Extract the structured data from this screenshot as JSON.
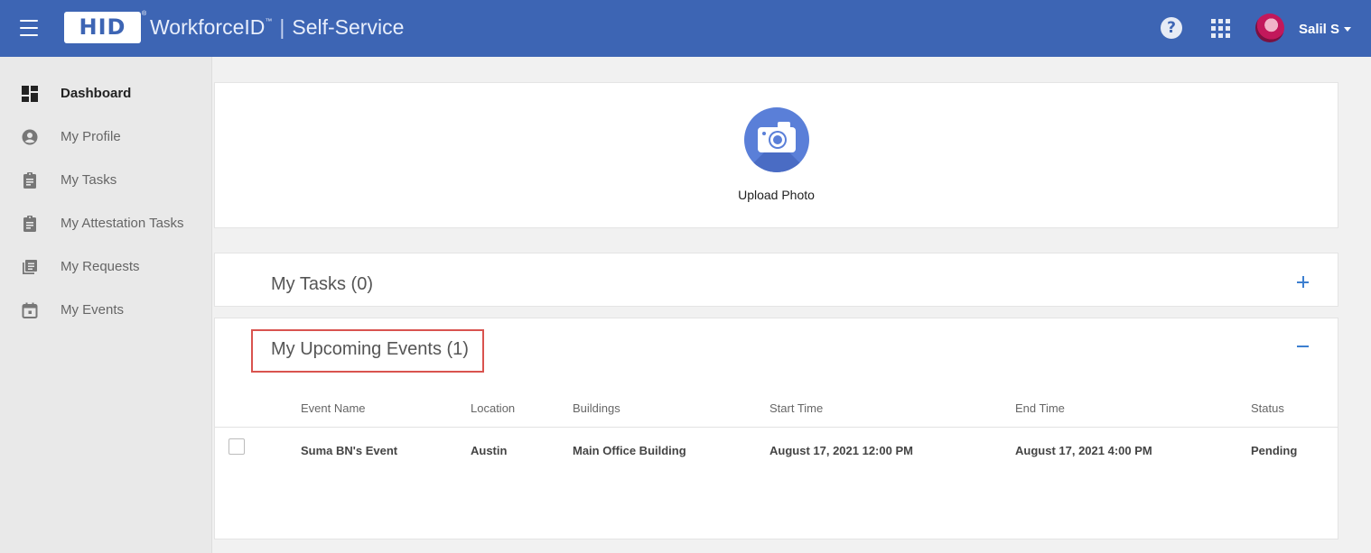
{
  "header": {
    "logo_text": "HID",
    "logo_mark": "®",
    "product_name": "WorkforceID",
    "product_tm": "™",
    "separator": "|",
    "service_name": "Self-Service",
    "help_glyph": "?",
    "user_name": "Salil S",
    "colors": {
      "bar": "#3d65b4"
    }
  },
  "sidebar": {
    "items": [
      {
        "label": "Dashboard",
        "icon": "dashboard-icon",
        "active": true
      },
      {
        "label": "My Profile",
        "icon": "account-circle-icon",
        "active": false
      },
      {
        "label": "My Tasks",
        "icon": "clipboard-icon",
        "active": false
      },
      {
        "label": "My Attestation Tasks",
        "icon": "clipboard-icon",
        "active": false
      },
      {
        "label": "My Requests",
        "icon": "list-stack-icon",
        "active": false
      },
      {
        "label": "My Events",
        "icon": "calendar-icon",
        "active": false
      }
    ]
  },
  "photo_card": {
    "upload_label": "Upload Photo"
  },
  "tasks_panel": {
    "title": "My Tasks (0)",
    "toggle": "expand"
  },
  "events_panel": {
    "title": "My Upcoming Events (1)",
    "toggle": "collapse",
    "columns": [
      "Event Name",
      "Location",
      "Buildings",
      "Start Time",
      "End Time",
      "Status"
    ],
    "rows": [
      {
        "event_name": "Suma BN's Event",
        "location": "Austin",
        "buildings": "Main Office Building",
        "start_time": "August 17, 2021 12:00 PM",
        "end_time": "August 17, 2021 4:00 PM",
        "status": "Pending"
      }
    ]
  }
}
